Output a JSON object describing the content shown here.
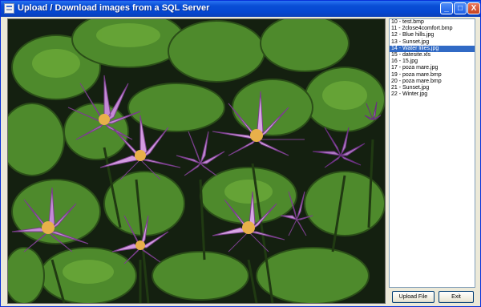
{
  "window": {
    "title": "Upload / Download images from a SQL Server",
    "controls": {
      "minimize": "_",
      "maximize": "□",
      "close": "X"
    }
  },
  "images_list": {
    "items": [
      "10 - test.bmp",
      "11 - 2close4comfort.bmp",
      "12 - Blue hills.jpg",
      "13 - Sunset.jpg",
      "14 - Water lilies.jpg",
      "15 - datesite.xls",
      "16 - 15.jpg",
      "17 - poza mare.jpg",
      "19 - poza mare.bmp",
      "20 - poza mare.bmp",
      "21 - Sunset.jpg",
      "22 - Winter.jpg"
    ],
    "selected_index": 4
  },
  "buttons": {
    "upload": "Upload File",
    "exit": "Exit"
  },
  "preview": {
    "subject": "water lilies",
    "colors": {
      "leaf": "#4e8a2c",
      "leaf_light": "#6fae3a",
      "petal": "#c48ad6",
      "petal_light": "#e8c6ef",
      "water": "#142010"
    }
  }
}
